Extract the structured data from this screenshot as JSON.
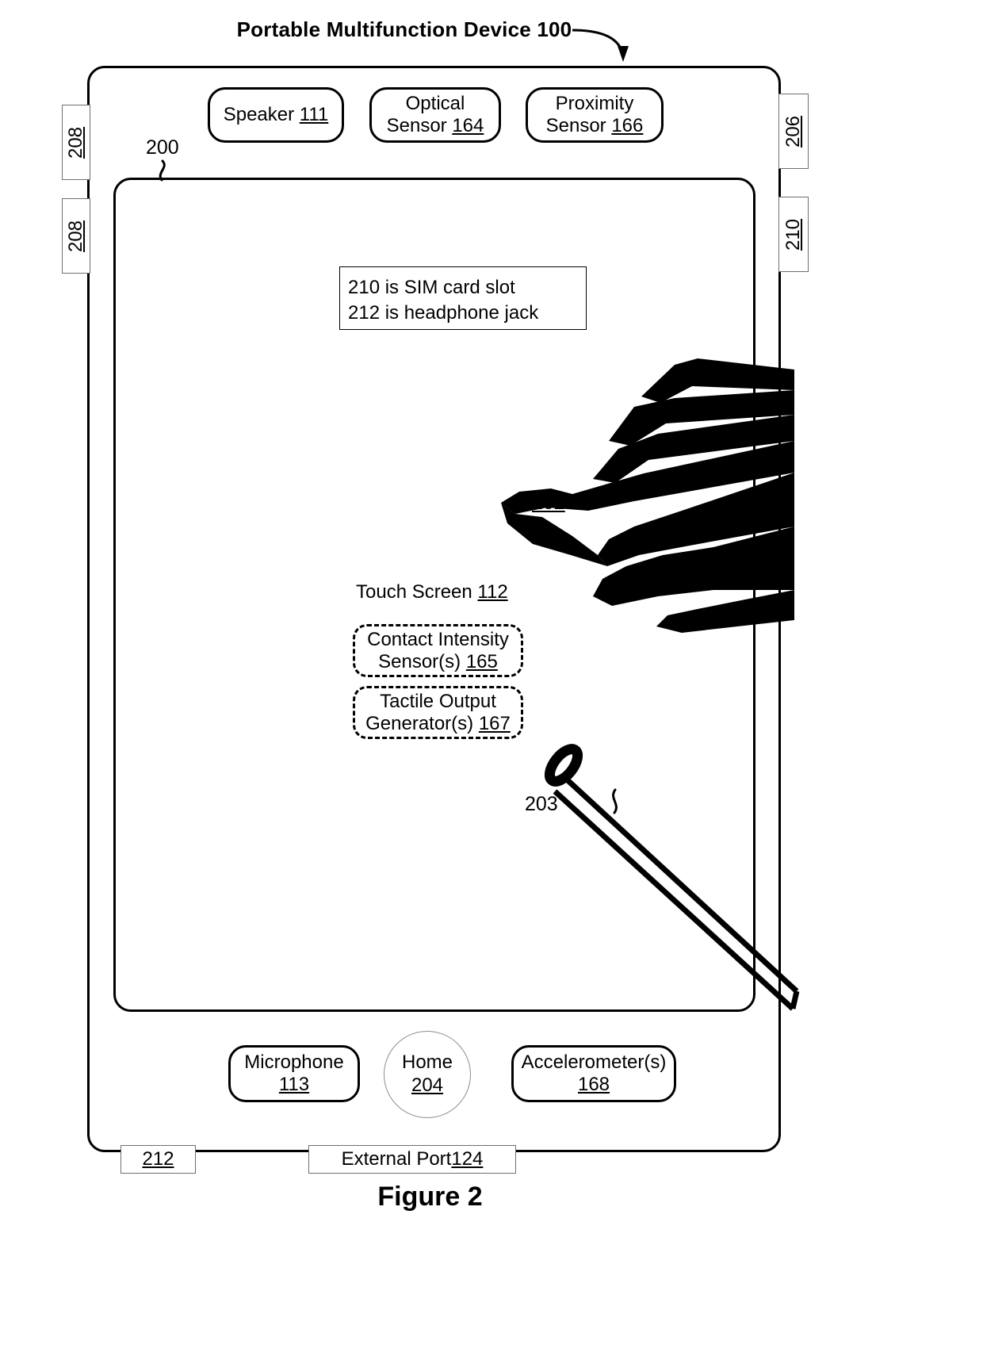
{
  "figure": {
    "title": "Portable Multifunction Device 100",
    "caption": "Figure 2"
  },
  "device": {
    "reference": "200",
    "top_components": [
      {
        "name": "speaker",
        "line1": "Speaker",
        "ref": "111"
      },
      {
        "name": "optical-sensor",
        "line1": "Optical",
        "line2": "Sensor",
        "ref": "164"
      },
      {
        "name": "proximity-sensor",
        "line1": "Proximity",
        "line2": "Sensor",
        "ref": "166"
      }
    ],
    "bottom_components": [
      {
        "name": "microphone",
        "line1": "Microphone",
        "ref": "113"
      },
      {
        "name": "home-button",
        "line1": "Home",
        "ref": "204"
      },
      {
        "name": "accelerometer",
        "line1": "Accelerometer(s)",
        "ref": "168"
      }
    ],
    "edge_tabs": [
      {
        "name": "tab-208-upper",
        "label": "208",
        "side": "left"
      },
      {
        "name": "tab-208-lower",
        "label": "208",
        "side": "left"
      },
      {
        "name": "tab-206",
        "label": "206",
        "side": "right"
      },
      {
        "name": "tab-210",
        "label": "210",
        "side": "right"
      }
    ],
    "bottom_tabs": [
      {
        "name": "tab-212",
        "label": "212"
      },
      {
        "name": "tab-external-port",
        "label": "External Port ",
        "ref": "124"
      }
    ]
  },
  "touch_screen": {
    "label": "Touch Screen ",
    "ref": "112",
    "sensors": [
      {
        "name": "contact-intensity-sensor",
        "line1": "Contact Intensity",
        "line2": "Sensor(s)",
        "ref": "165",
        "style": "dashed"
      },
      {
        "name": "tactile-output-generator",
        "line1": "Tactile Output",
        "line2": "Generator(s)",
        "ref": "167",
        "style": "dashed"
      }
    ]
  },
  "note": {
    "line1": "210 is SIM card slot",
    "line2": "212 is headphone jack"
  },
  "annotations": {
    "finger_contact": "202",
    "stylus": "203"
  },
  "colors": {
    "ink": "#000000",
    "tab_outline": "#6e6e6e",
    "home_outline": "#8d8d8d",
    "background": "#ffffff"
  }
}
